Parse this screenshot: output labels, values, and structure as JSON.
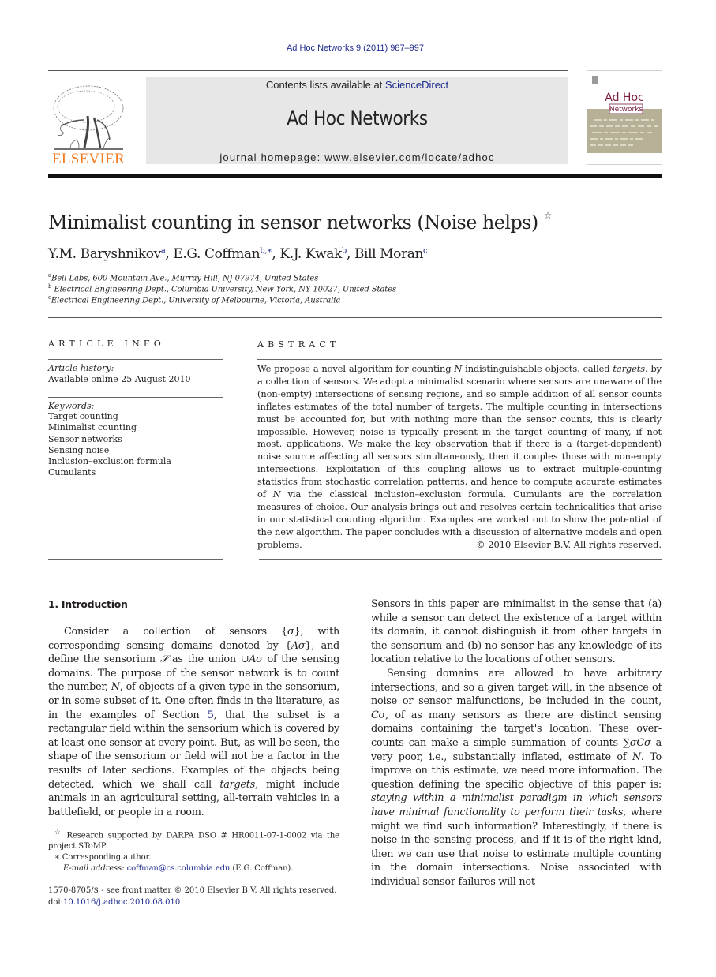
{
  "journal_ref": "Ad Hoc Networks 9 (2011) 987–997",
  "header": {
    "publisher_name": "ELSEVIER",
    "contents_prefix": "Contents lists available at ",
    "contents_link": "ScienceDirect",
    "journal_title": "Ad Hoc Networks",
    "homepage": "journal homepage: www.elsevier.com/locate/adhoc",
    "cover_title_line1": "Ad Hoc",
    "cover_title_line2": "Networks",
    "colors": {
      "publisher_orange": "#f47a20",
      "link_blue": "#1d2a8c",
      "header_gray": "#e7e7e7",
      "cover_olive": "#b5b096"
    }
  },
  "article": {
    "title": "Minimalist counting in sensor networks (Noise helps)",
    "title_note_mark": "☆",
    "authors": [
      {
        "name": "Y.M. Baryshnikov",
        "marks": "a"
      },
      {
        "name": "E.G. Coffman",
        "marks": "b,∗"
      },
      {
        "name": "K.J. Kwak",
        "marks": "b"
      },
      {
        "name": "Bill Moran",
        "marks": "c"
      }
    ],
    "affiliations": [
      {
        "mark": "a",
        "text": "Bell Labs, 600 Mountain Ave., Murray Hill, NJ 07974, United States"
      },
      {
        "mark": "b",
        "text": "Electrical Engineering Dept., Columbia University, New York, NY 10027, United States"
      },
      {
        "mark": "c",
        "text": "Electrical Engineering Dept., University of Melbourne, Victoria, Australia"
      }
    ]
  },
  "article_info": {
    "heading": "ARTICLE INFO",
    "history_label": "Article history:",
    "history_value": "Available online 25 August 2010",
    "keywords_label": "Keywords:",
    "keywords": [
      "Target counting",
      "Minimalist counting",
      "Sensor networks",
      "Sensing noise",
      "Inclusion–exclusion formula",
      "Cumulants"
    ]
  },
  "abstract": {
    "heading": "ABSTRACT",
    "p1": "We propose a novel algorithm for counting ",
    "N": "N",
    "p2": " indistinguishable objects, called ",
    "targets": "targets",
    "p3": ", by a collection of sensors. We adopt a minimalist scenario where sensors are unaware of the (non-empty) intersections of sensing regions, and so simple addition of all sensor counts inflates estimates of the total number of targets. The multiple counting in intersections must be accounted for, but with nothing more than the sensor counts, this is clearly impossible. However, noise is typically present in the target counting of many, if not most, applications. We make the key observation that if there is a (target-dependent) noise source affecting all sensors simultaneously, then it couples those with non-empty intersections. Exploitation of this coupling allows us to extract multiple-counting statistics from stochastic correlation patterns, and hence to compute accurate estimates of ",
    "p4": " via the classical inclusion–exclusion formula. Cumulants are the correlation measures of choice. Our analysis brings out and resolves certain technicalities that arise in our statistical counting algorithm. Examples are worked out to show the potential of the new algorithm. The paper concludes with a discussion of alternative models and open problems.",
    "copyright": "© 2010 Elsevier B.V. All rights reserved."
  },
  "intro": {
    "heading": "1. Introduction",
    "left": {
      "a": "Consider a collection of sensors {",
      "sigma": "σ",
      "b": "}, with corresponding sensing domains denoted by {",
      "A_sigma": "Aσ",
      "c": "}, and define the sensorium ",
      "S": "𝒮",
      "d": " as the union ∪",
      "e": " of the sensing domains. The purpose of the sensor network is to count the number, ",
      "N": "N",
      "f": ", of objects of a given type in the sensorium, or in some subset of it. One often finds in the literature, as in the examples of Section ",
      "section_link": "5",
      "g": ", that the subset is a rectangular field within the sensorium which is covered by at least one sensor at every point. But, as will be seen, the shape of the sensorium or field will not be a factor in the results of later sections. Examples of the objects being detected, which we shall call ",
      "targets": "targets",
      "h": ", might include animals in an agricultural setting, all-terrain vehicles in a battlefield, or people in a room."
    },
    "right": {
      "p1": "Sensors in this paper are minimalist in the sense that (a) while a sensor can detect the existence of a target within its domain, it cannot distinguish it from other targets in the sensorium and (b) no sensor has any knowledge of its location relative to the locations of other sensors.",
      "p2a": "Sensing domains are allowed to have arbitrary intersections, and so a given target will, in the absence of noise or sensor malfunctions, be included in the count, ",
      "C_sigma": "Cσ",
      "p2b": ", of as many sensors as there are distinct sensing domains containing the target's location. These over-counts can make a simple summation of counts ",
      "sum": "∑σCσ",
      "p2c": " a very poor, i.e., substantially inflated, estimate of ",
      "N": "N",
      "p2d": ". To improve on this estimate, we need more information. The question defining the specific objective of this paper is: ",
      "p2e_italic": "staying within a minimalist paradigm in which sensors have minimal functionality to perform their tasks",
      "p2f": ", where might we find such information? Interestingly, if there is noise in the sensing process, and if it is of the right kind, then we can use that noise to estimate multiple counting in the domain intersections. Noise associated with individual sensor failures will not"
    }
  },
  "footnotes": {
    "star_mark": "☆",
    "star_text": " Research supported by DARPA DSO # HR0011-07-1-0002 via the project SToMP.",
    "corr_mark": "∗",
    "corr_text": " Corresponding author.",
    "email_label": "E-mail address: ",
    "email": "coffman@cs.columbia.edu",
    "email_suffix": " (E.G. Coffman).",
    "front_matter": "1570-8705/$ - see front matter © 2010 Elsevier B.V. All rights reserved.",
    "doi_label": "doi:",
    "doi": "10.1016/j.adhoc.2010.08.010"
  }
}
